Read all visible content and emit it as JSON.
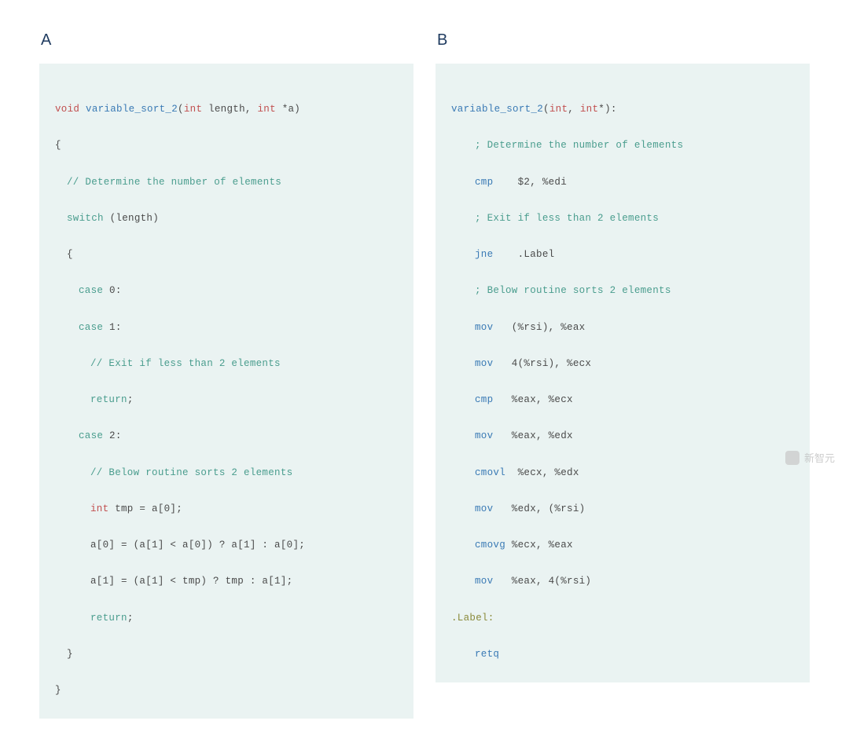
{
  "panels": {
    "a": {
      "label": "A"
    },
    "b": {
      "label": "B"
    }
  },
  "code_a": {
    "l1_void": "void",
    "l1_name": " variable_sort_2",
    "l1_paren_open": "(",
    "l1_int1": "int",
    "l1_length": " length, ",
    "l1_int2": "int",
    "l1_ptr": " *a)",
    "l2": "{",
    "l3_comment": "// Determine the number of elements",
    "l4_switch": "switch",
    "l4_rest": " (length)",
    "l5": "{",
    "l6_case": "case",
    "l6_rest": " 0:",
    "l7_case": "case",
    "l7_rest": " 1:",
    "l8_comment": "// Exit if less than 2 elements",
    "l9_return": "return",
    "l9_semi": ";",
    "l10_case": "case",
    "l10_rest": " 2:",
    "l11_comment": "// Below routine sorts 2 elements",
    "l12_int": "int",
    "l12_rest": " tmp = a[0];",
    "l13": "a[0] = (a[1] < a[0]) ? a[1] : a[0];",
    "l14": "a[1] = (a[1] < tmp) ? tmp : a[1];",
    "l15_return": "return",
    "l15_semi": ";",
    "l16": "}",
    "l17": "}"
  },
  "code_b": {
    "l1_name": "variable_sort_2",
    "l1_paren_open": "(",
    "l1_int1": "int",
    "l1_comma": ", ",
    "l1_int2": "int",
    "l1_ptr": "*):",
    "l2_comment": "; Determine the number of elements",
    "l3_op": "cmp",
    "l3_args": "    $2, %edi",
    "l4_comment": "; Exit if less than 2 elements",
    "l5_op": "jne",
    "l5_args": "    .Label",
    "l6_comment": "; Below routine sorts 2 elements",
    "l7_op": "mov",
    "l7_args": "   (%rsi), %eax",
    "l8_op": "mov",
    "l8_args": "   4(%rsi), %ecx",
    "l9_op": "cmp",
    "l9_args": "   %eax, %ecx",
    "l10_op": "mov",
    "l10_args": "   %eax, %edx",
    "l11_op": "cmovl",
    "l11_args": "  %ecx, %edx",
    "l12_op": "mov",
    "l12_args": "   %edx, (%rsi)",
    "l13_op": "cmovg",
    "l13_args": " %ecx, %eax",
    "l14_op": "mov",
    "l14_args": "   %eax, 4(%rsi)",
    "l15_label": ".Label:",
    "l16_op": "retq"
  },
  "watermark": "新智元"
}
